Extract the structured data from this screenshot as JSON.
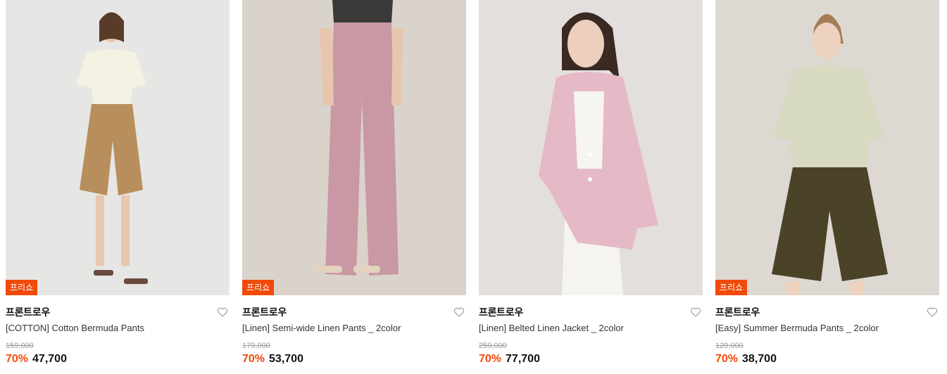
{
  "products": [
    {
      "badge": "프리쇼",
      "brand": "프론트로우",
      "name": "[COTTON] Cotton Bermuda Pants",
      "original_price": "159,000",
      "discount": "70%",
      "price": "47,700",
      "bg_color": "#e6e6e4",
      "top_color": "#f4f0e2",
      "bottom_color": "#b88f5c"
    },
    {
      "badge": "프리쇼",
      "brand": "프론트로우",
      "name": "[Linen] Semi-wide Linen Pants _ 2color",
      "original_price": "179,000",
      "discount": "70%",
      "price": "53,700",
      "bg_color": "#d9d3cb",
      "top_color": "#3a3a38",
      "bottom_color": "#c998a4"
    },
    {
      "badge": "",
      "brand": "프론트로우",
      "name": "[Linen] Belted Linen Jacket _ 2color",
      "original_price": "259,000",
      "discount": "70%",
      "price": "77,700",
      "bg_color": "#e3dfdc",
      "top_color": "#e6b9c6",
      "bottom_color": "#f6f4ef"
    },
    {
      "badge": "프리쇼",
      "brand": "프론트로우",
      "name": "[Easy] Summer Bermuda Pants _ 2color",
      "original_price": "129,000",
      "discount": "70%",
      "price": "38,700",
      "bg_color": "#ddd8d2",
      "top_color": "#d8d9c1",
      "bottom_color": "#4a4328"
    }
  ]
}
